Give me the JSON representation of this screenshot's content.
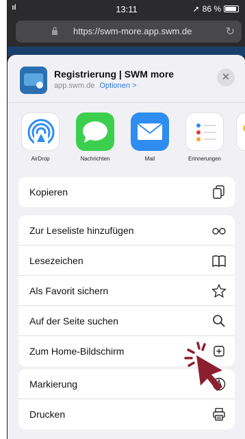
{
  "status": {
    "signal": "ııl",
    "time": "13:11",
    "battery": "86 %",
    "location_arrow": "➚"
  },
  "browser": {
    "url": "https://swm-more.app.swm.de",
    "reload": "↻"
  },
  "share": {
    "title": "Registrierung | SWM more",
    "domain": "app.swm.de",
    "options": "Optionen >",
    "close": "✕",
    "apps": [
      {
        "label": "AirDrop"
      },
      {
        "label": "Nachrichten"
      },
      {
        "label": "Mail"
      },
      {
        "label": "Erinnerungen"
      }
    ],
    "group1": [
      {
        "label": "Kopieren"
      }
    ],
    "group2": [
      {
        "label": "Zur Leseliste hinzufügen"
      },
      {
        "label": "Lesezeichen"
      },
      {
        "label": "Als Favorit sichern"
      },
      {
        "label": "Auf der Seite suchen"
      },
      {
        "label": "Zum Home-Bildschirm"
      }
    ],
    "group3": [
      {
        "label": "Markierung"
      },
      {
        "label": "Drucken"
      }
    ]
  },
  "colors": {
    "accent": "#2f7bd9",
    "cursor": "#8c1f2f"
  }
}
